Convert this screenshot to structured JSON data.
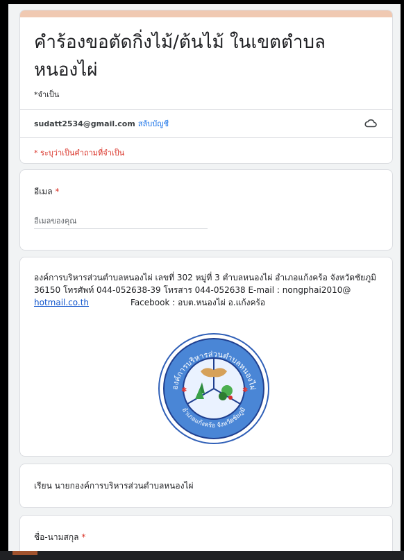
{
  "form": {
    "title": "คำร้องขอตัดกิ่งไม้/ต้นไม้ ในเขตตำบลหนองไผ่",
    "required_note": "*จำเป็น",
    "account_email": "sudatt2534@gmail.com",
    "switch_account": "สลับบัญชี",
    "required_alert": "* ระบุว่าเป็นคำถามที่จำเป็น"
  },
  "email_question": {
    "label": "อีเมล",
    "required_mark": "*",
    "placeholder": "อีเมลของคุณ"
  },
  "info": {
    "line_main": "องค์การบริหารส่วนตำบลหนองไผ่  เลขที่ 302 หมู่ที่ 3 ตำบลหนองไผ่ อำเภอแก้งคร้อ จังหวัดชัยภูมิ  36150  โทรศัพท์ 044-052638-39  โทรสาร 044-052638  E-mail : nongphai2010@ ",
    "email_link": "hotmail.co.th",
    "facebook": "Facebook : อบต.หนองไผ่ อ.แก้งคร้อ",
    "seal_text_top": "องค์การบริหารส่วนตำบลหนองไผ่",
    "seal_text_bottom": "อำเภอแก้งคร้อ จังหวัดชัยภูมิ"
  },
  "salutation": {
    "text": "เรียน  นายกองค์การบริหารส่วนตำบลหนองไผ่"
  },
  "name_question": {
    "label": "ชื่อ-นามสกุล",
    "required_mark": "*"
  },
  "colors": {
    "header_accent": "#f0c9b2",
    "required_red": "#d93025",
    "link_blue": "#1a73e8"
  },
  "icons": {
    "cloud": "cloud-icon"
  }
}
